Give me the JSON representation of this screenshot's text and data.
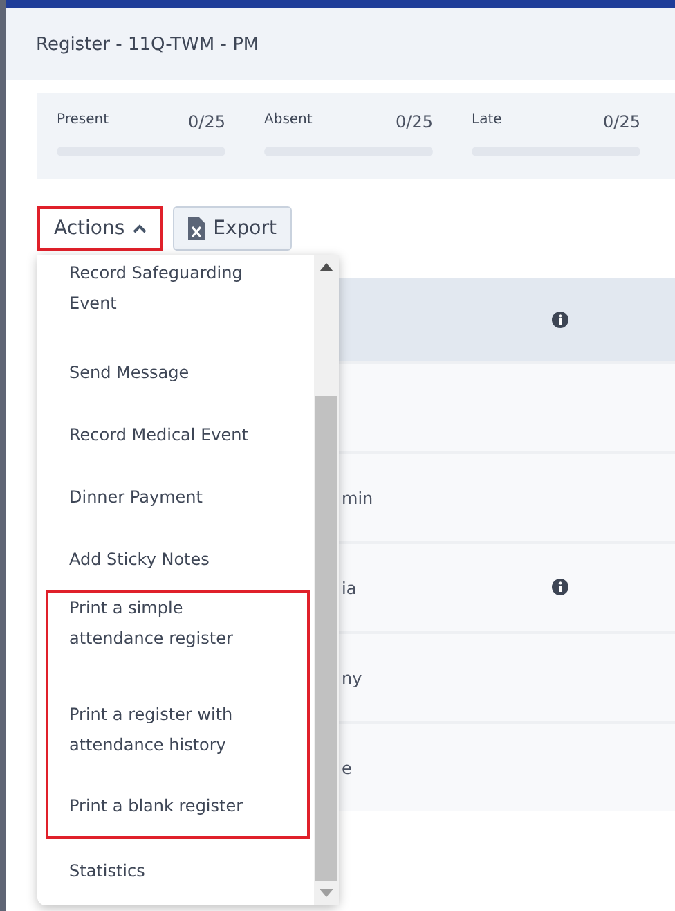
{
  "window": {
    "title": "Register - 11Q-TWM - PM"
  },
  "stats": [
    {
      "label": "Present",
      "count": "0/25",
      "level": 0
    },
    {
      "label": "Absent",
      "count": "0/25",
      "level": 0
    },
    {
      "label": "Late",
      "count": "0/25",
      "level": 0
    }
  ],
  "toolbar": {
    "actions": {
      "label": "Actions",
      "expanded": true,
      "highlighted": true
    },
    "export": {
      "label": "Export"
    }
  },
  "actions_menu": [
    {
      "label": "Record Safeguarding Event",
      "highlighted": false
    },
    {
      "label": "Send Message",
      "highlighted": false
    },
    {
      "label": "Record Medical Event",
      "highlighted": false
    },
    {
      "label": "Dinner Payment",
      "highlighted": false
    },
    {
      "label": "Add Sticky Notes",
      "highlighted": false
    },
    {
      "label": "Print a simple attendance register",
      "highlighted": true
    },
    {
      "label": "Print a register with attendance history",
      "highlighted": true
    },
    {
      "label": "Print a blank register",
      "highlighted": true
    },
    {
      "label": "Statistics",
      "highlighted": false
    }
  ],
  "table": {
    "header": {
      "info": true
    },
    "rows": [
      {
        "name": "",
        "info": false
      },
      {
        "name": "min",
        "info": false
      },
      {
        "name": "ia",
        "info": true
      },
      {
        "name": "ny",
        "info": false
      },
      {
        "name": "e",
        "info": false
      }
    ]
  }
}
